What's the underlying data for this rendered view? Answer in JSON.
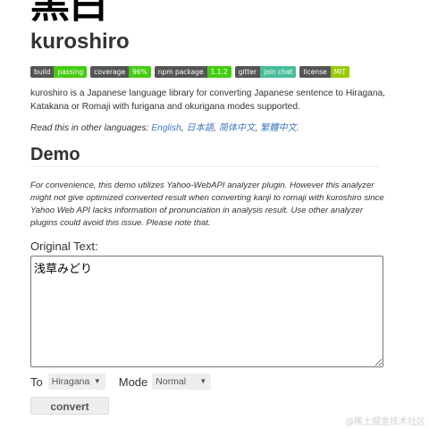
{
  "logo": {
    "text": "黑白"
  },
  "title": "kuroshiro",
  "badges": [
    {
      "label": "build",
      "value": "passing",
      "color": "#4c1"
    },
    {
      "label": "coverage",
      "value": "96%",
      "color": "#4c1"
    },
    {
      "label": "npm package",
      "value": "1.1.2",
      "color": "#4c1"
    },
    {
      "label": "gitter",
      "value": "join chat",
      "color": "#46bc99"
    },
    {
      "label": "license",
      "value": "MIT",
      "color": "#97ca00"
    }
  ],
  "description": "kuroshiro is a Japanese language library for converting Japanese sentence to Hiragana, Katakana or Romaji with furigana and okurigana modes supported.",
  "languages": {
    "prefix": "Read this in other languages: ",
    "items": [
      "English",
      "日本語",
      "简体中文",
      "繁體中文"
    ],
    "suffix": "."
  },
  "demo_heading": "Demo",
  "note": "For convenience, this demo utilizes Yahoo-WebAPI analyzer plugin. However this analyzer might not give optimized converted result when converting kanji to romaji with kuroshiro since Yahoo Web API lacks information of pronunciation in analysis result. Use other analyzer plugins could avoid this issue. Please note that.",
  "original_text_label": "Original Text:",
  "original_text_value": "浅草みどり",
  "to_label": "To",
  "to_value": "Hiragana",
  "mode_label": "Mode",
  "mode_value": "Normal",
  "convert_label": "convert",
  "watermark": "@稀土掘金技术社区"
}
